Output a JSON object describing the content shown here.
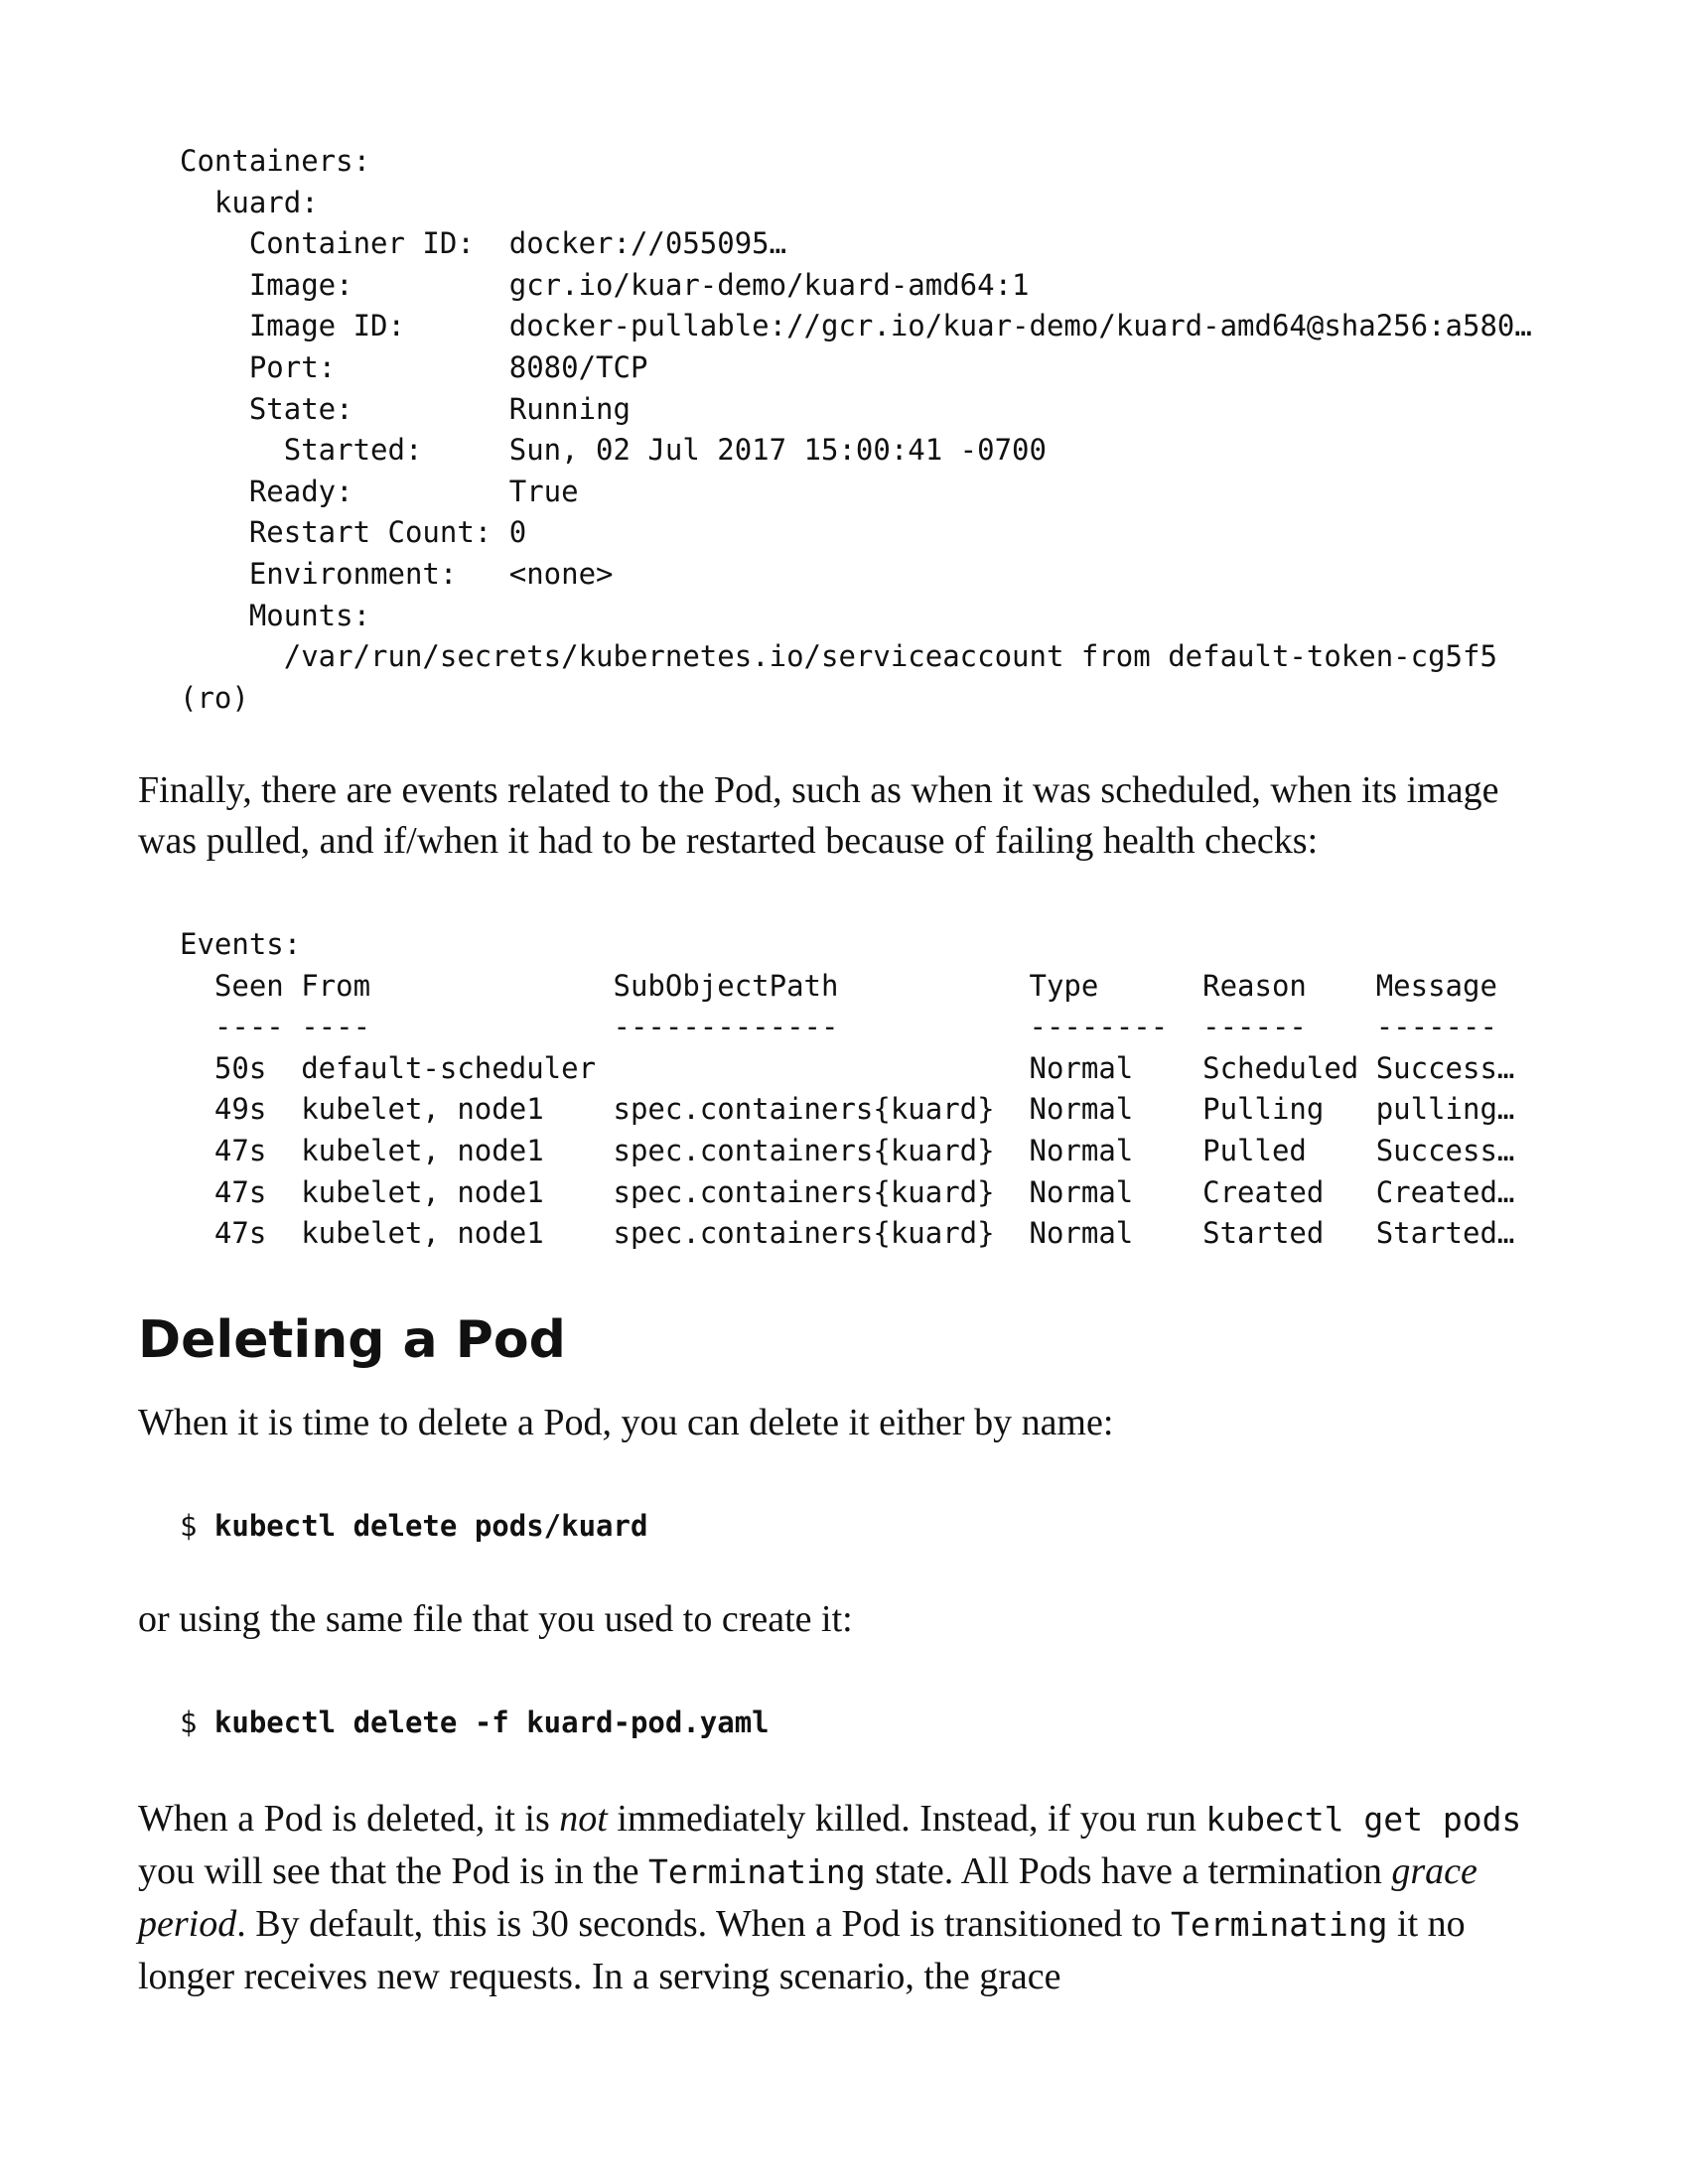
{
  "containers_block": "Containers:\n  kuard:\n    Container ID:  docker://055095…\n    Image:         gcr.io/kuar-demo/kuard-amd64:1\n    Image ID:      docker-pullable://gcr.io/kuar-demo/kuard-amd64@sha256:a580…\n    Port:          8080/TCP\n    State:         Running\n      Started:     Sun, 02 Jul 2017 15:00:41 -0700\n    Ready:         True\n    Restart Count: 0\n    Environment:   <none>\n    Mounts:\n      /var/run/secrets/kubernetes.io/serviceaccount from default-token-cg5f5\n(ro)",
  "events_intro": "Finally, there are events related to the Pod, such as when it was scheduled, when its image was pulled, and if/when it had to be restarted because of failing health checks:",
  "events_block": "Events:\n  Seen From              SubObjectPath           Type      Reason    Message\n  ---- ----              -------------           --------  ------    -------\n  50s  default-scheduler                         Normal    Scheduled Success…\n  49s  kubelet, node1    spec.containers{kuard}  Normal    Pulling   pulling…\n  47s  kubelet, node1    spec.containers{kuard}  Normal    Pulled    Success…\n  47s  kubelet, node1    spec.containers{kuard}  Normal    Created   Created…\n  47s  kubelet, node1    spec.containers{kuard}  Normal    Started   Started…",
  "section_heading": "Deleting a Pod",
  "delete_intro": "When it is time to delete a Pod, you can delete it either by name:",
  "cmd1": {
    "prompt": "$ ",
    "command": "kubectl delete pods/kuard"
  },
  "file_intro": "or using the same file that you used to create it:",
  "cmd2": {
    "prompt": "$ ",
    "command": "kubectl delete -f kuard-pod.yaml"
  },
  "final_para": {
    "t1": "When a Pod is deleted, it is ",
    "em1": "not",
    "t2": " immediately killed. Instead, if you run ",
    "code1": "kubectl get pods",
    "t3": " you will see that the Pod is in the ",
    "code2": "Terminating",
    "t4": " state. All Pods have a termination ",
    "em2": "grace period",
    "t5": ". By default, this is 30 seconds. When a Pod is transitioned to ",
    "code3": "Terminating",
    "t6": " it no longer receives new requests. In a serving scenario, the grace"
  }
}
